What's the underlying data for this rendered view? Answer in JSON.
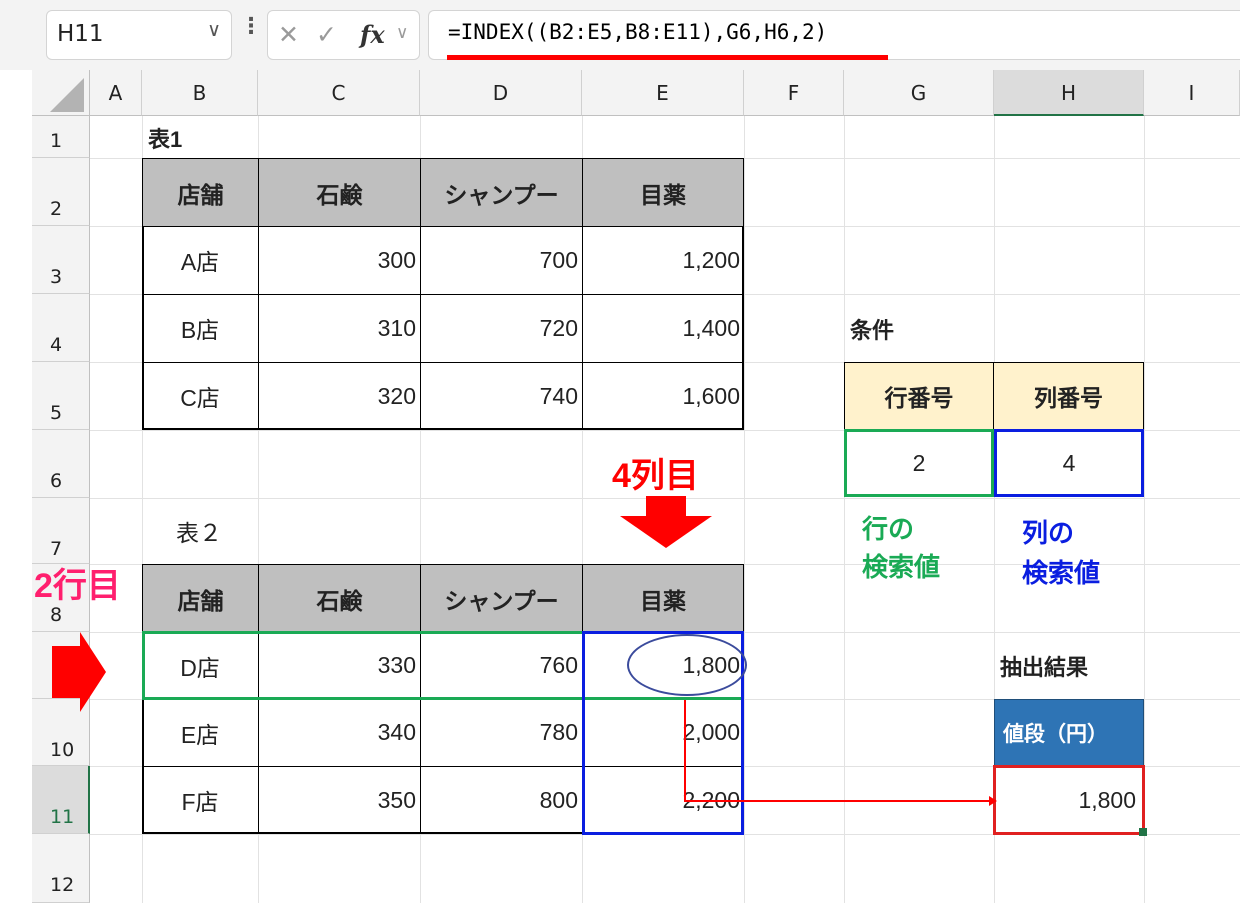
{
  "namebox": {
    "cell": "H11"
  },
  "formula": {
    "text": "=INDEX((B2:E5,B8:E11),G6,H6,2)"
  },
  "icons": {
    "chevron": "chevron-down-icon",
    "cancel": "x-icon",
    "enter": "check-icon",
    "fx": "fx-icon"
  },
  "columns": [
    "A",
    "B",
    "C",
    "D",
    "E",
    "F",
    "G",
    "H",
    "I"
  ],
  "rows": [
    "1",
    "2",
    "3",
    "4",
    "5",
    "6",
    "7",
    "8",
    "",
    "10",
    "11",
    "12"
  ],
  "table1": {
    "title": "表1",
    "headers": [
      "店舗",
      "石鹸",
      "シャンプー",
      "目薬"
    ],
    "rows": [
      [
        "A店",
        "300",
        "700",
        "1,200"
      ],
      [
        "B店",
        "310",
        "720",
        "1,400"
      ],
      [
        "C店",
        "320",
        "740",
        "1,600"
      ]
    ]
  },
  "table2": {
    "title": "表２",
    "headers": [
      "店舗",
      "石鹸",
      "シャンプー",
      "目薬"
    ],
    "rows": [
      [
        "D店",
        "330",
        "760",
        "1,800"
      ],
      [
        "E店",
        "340",
        "780",
        "2,000"
      ],
      [
        "F店",
        "350",
        "800",
        "2,200"
      ]
    ]
  },
  "conditions": {
    "title": "条件",
    "row_header": "行番号",
    "col_header": "列番号",
    "row_value": "2",
    "col_value": "4"
  },
  "result": {
    "title": "抽出結果",
    "header": "値段（円）",
    "value": "1,800"
  },
  "annotations": {
    "col_label": "4列目",
    "row_label": "2行目",
    "row_lookup_1": "行の",
    "row_lookup_2": "検索値",
    "col_lookup_1": "列の",
    "col_lookup_2": "検索値"
  },
  "colors": {
    "red": "#ff0000",
    "pink": "#ff1f6e",
    "green": "#1aaa55",
    "blue": "#0a1ee0",
    "header_gray": "#bfbfbf",
    "cond_header": "#fff2cc",
    "result_header": "#2e74b5"
  }
}
